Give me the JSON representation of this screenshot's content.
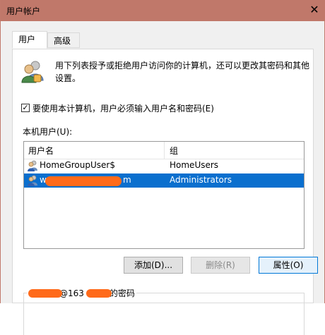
{
  "window": {
    "title": "用户帐户",
    "close_glyph": "✕",
    "titlebar_color": "#c0786a"
  },
  "tabs": [
    {
      "label": "用户",
      "active": true
    },
    {
      "label": "高级",
      "active": false
    }
  ],
  "description": "用下列表授予或拒绝用户访问你的计算机，还可以更改其密码和其他设置。",
  "require_login": {
    "checked": true,
    "label": "要使用本计算机，用户必须输入用户名和密码(E)"
  },
  "local_users_label": "本机用户(U):",
  "user_list": {
    "columns": [
      "用户名",
      "组"
    ],
    "rows": [
      {
        "name": "HomeGroupUser$",
        "group": "HomeUsers",
        "selected": false,
        "name_redacted": false
      },
      {
        "name": "w",
        "name_suffix": "m",
        "group": "Administrators",
        "selected": true,
        "name_redacted": true
      }
    ],
    "selection_color": "#0a6fce"
  },
  "buttons": {
    "add": "添加(D)...",
    "remove": "删除(R)",
    "properties": "属性(O)"
  },
  "password_group": {
    "legend_middle": "@163",
    "legend_suffix": "的密码"
  },
  "redaction_color": "#ff6a1a"
}
